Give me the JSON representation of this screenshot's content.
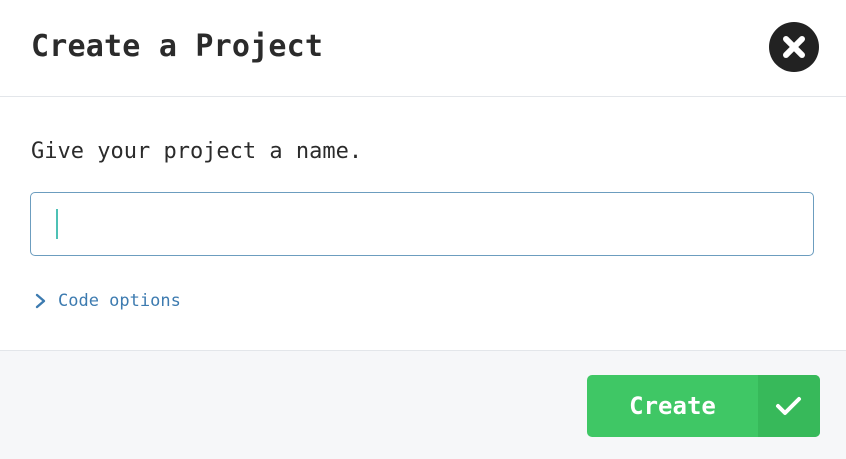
{
  "dialog": {
    "title": "Create a Project",
    "close_icon": "close-icon"
  },
  "body": {
    "prompt": "Give your project a name.",
    "name_input": {
      "value": "",
      "placeholder": ""
    },
    "code_options": {
      "label": "Code options",
      "icon": "chevron-right-icon"
    }
  },
  "footer": {
    "create_label": "Create",
    "create_icon": "check-icon"
  },
  "colors": {
    "accent_green": "#3fc765",
    "link_blue": "#3d7bb0",
    "input_border": "#6c9dbf",
    "caret": "#4ec1b5",
    "close_bg": "#222222"
  }
}
